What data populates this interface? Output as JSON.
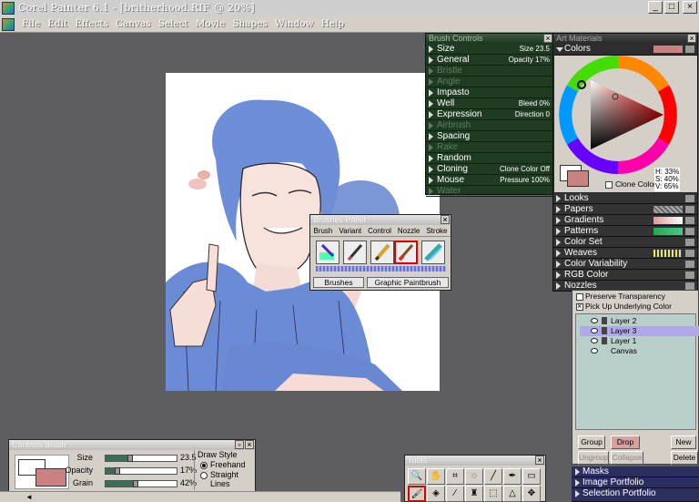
{
  "window": {
    "title": "Corel Painter 6.1 - [britherhood.RIF @ 20%]",
    "minimize": "_",
    "maximize": "□",
    "close": "×"
  },
  "menu": [
    "File",
    "Edit",
    "Effects",
    "Canvas",
    "Select",
    "Movie",
    "Shapes",
    "Window",
    "Help"
  ],
  "brush_controls": {
    "title": "Brush Controls",
    "rows": [
      {
        "label": "Size",
        "value": "Size 23.5",
        "dim": false
      },
      {
        "label": "General",
        "value": "Opacity 17%",
        "dim": false
      },
      {
        "label": "Bristle",
        "value": "",
        "dim": true
      },
      {
        "label": "Angle",
        "value": "",
        "dim": true
      },
      {
        "label": "Impasto",
        "value": "",
        "dim": false
      },
      {
        "label": "Well",
        "value": "Bleed 0%",
        "dim": false
      },
      {
        "label": "Expression",
        "value": "Direction 0",
        "dim": false
      },
      {
        "label": "Airbrush",
        "value": "",
        "dim": true
      },
      {
        "label": "Spacing",
        "value": "",
        "dim": false
      },
      {
        "label": "Rake",
        "value": "",
        "dim": true
      },
      {
        "label": "Random",
        "value": "",
        "dim": false
      },
      {
        "label": "Cloning",
        "value": "Clone Color Off",
        "dim": false
      },
      {
        "label": "Mouse",
        "value": "Pressure 100%",
        "dim": false
      },
      {
        "label": "Water",
        "value": "",
        "dim": true
      }
    ]
  },
  "art_materials": {
    "title": "Art Materials",
    "colors_label": "Colors",
    "hsv": {
      "h": "H: 33%",
      "s": "S: 40%",
      "v": "V: 65%"
    },
    "clone_color": "Clone Color",
    "sections": [
      "Looks",
      "Papers",
      "Gradients",
      "Patterns",
      "Color Set",
      "Weaves",
      "Color Variability",
      "RGB Color",
      "Nozzles"
    ],
    "primary_color": "#c98181",
    "secondary_color": "#ffffff"
  },
  "layers": {
    "preserve_transparency": "Preserve Transparency",
    "pick_up_underlying": "Pick Up Underlying Color",
    "items": [
      "Layer 2",
      "Layer 3",
      "Layer 1",
      "Canvas"
    ],
    "selected": "Layer 3",
    "buttons": {
      "group": "Group",
      "drop": "Drop",
      "new": "New",
      "ungroup": "Ungroup",
      "collapse": "Collapse",
      "delete": "Delete"
    }
  },
  "bottom_palettes": [
    "Masks",
    "Image Portfolio",
    "Selection Portfolio"
  ],
  "brushes": {
    "title": "Brushes Pallet",
    "tabs": [
      "Brush",
      "Variant",
      "Control",
      "Nozzle",
      "Stroke"
    ],
    "category": "Brushes",
    "variant": "Graphic Paintbrush"
  },
  "controls_brush": {
    "title": "Controls:Brush",
    "sliders": [
      {
        "label": "Size",
        "value": "23.5",
        "fraction": 0.34
      },
      {
        "label": "Opacity",
        "value": "17%",
        "fraction": 0.17
      },
      {
        "label": "Grain",
        "value": "42%",
        "fraction": 0.42
      }
    ],
    "draw_style": "Draw Style",
    "freehand": "Freehand",
    "straight": "Straight Lines"
  },
  "tools": {
    "title": "Tools"
  }
}
